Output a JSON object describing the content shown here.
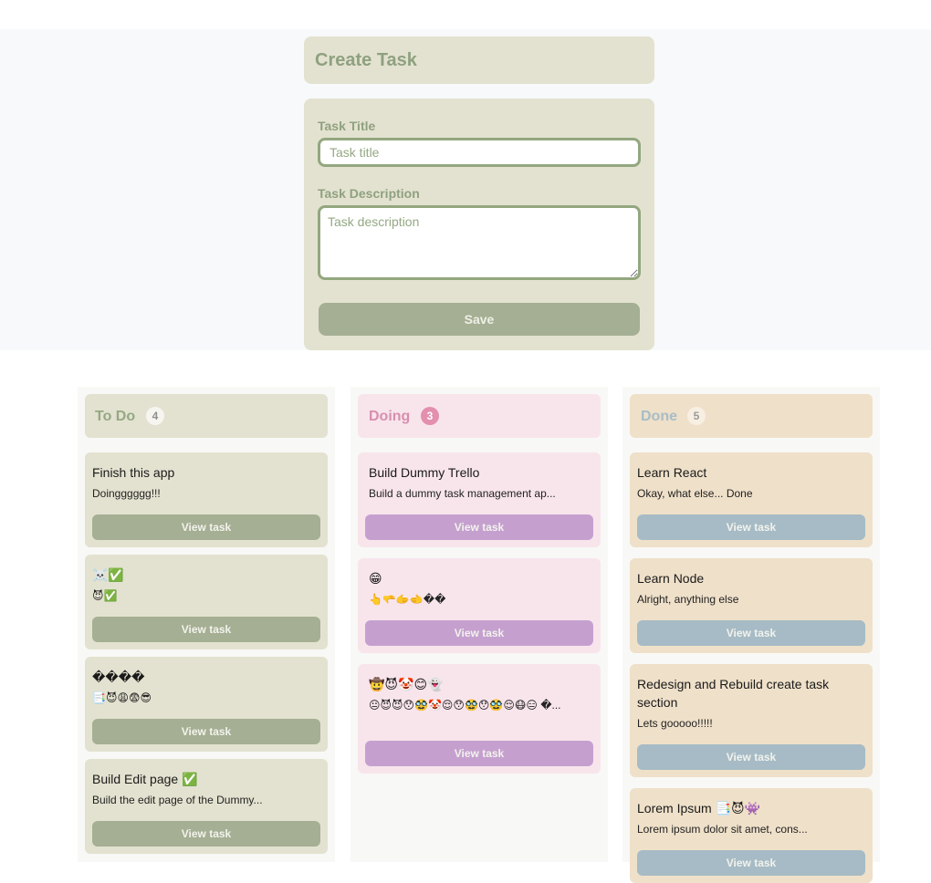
{
  "create_task": {
    "heading": "Create Task",
    "title_label": "Task Title",
    "title_placeholder": "Task title",
    "title_value": "",
    "description_label": "Task Description",
    "description_placeholder": "Task description",
    "description_value": "",
    "save_label": "Save"
  },
  "columns": [
    {
      "title": "To Do",
      "count": "4",
      "cards": [
        {
          "title": "Finish this app",
          "description": "Doingggggg!!!",
          "button": "View task"
        },
        {
          "title": "☠️✅",
          "description": "😈✅",
          "button": "View task"
        },
        {
          "title": "����",
          "description": "📑😈😩😨😎",
          "button": "View task"
        },
        {
          "title": "Build Edit page ✅",
          "description": "Build the edit page of the Dummy...",
          "button": "View task"
        }
      ]
    },
    {
      "title": "Doing",
      "count": "3",
      "cards": [
        {
          "title": "Build Dummy Trello",
          "description": "Build a dummy task management ap...",
          "button": "View task"
        },
        {
          "title": "😁",
          "description": "👆🫳🫱🫲��",
          "button": "View task"
        },
        {
          "title": "🤠😈🤡😊👻",
          "description": "😐😈😈😯🥸🤡😌😯🥸😯🥸😌😷😑 �...",
          "button": "View task"
        }
      ]
    },
    {
      "title": "Done",
      "count": "5",
      "cards": [
        {
          "title": "Learn React",
          "description": "Okay, what else... Done",
          "button": "View task"
        },
        {
          "title": "Learn Node",
          "description": "Alright, anything else",
          "button": "View task"
        },
        {
          "title": "Redesign and Rebuild create task section",
          "description": "Lets gooooo!!!!!",
          "button": "View task"
        },
        {
          "title": "Lorem Ipsum 📑😈👾",
          "description": "Lorem ipsum dolor sit amet, cons...",
          "button": "View task"
        }
      ]
    }
  ]
}
